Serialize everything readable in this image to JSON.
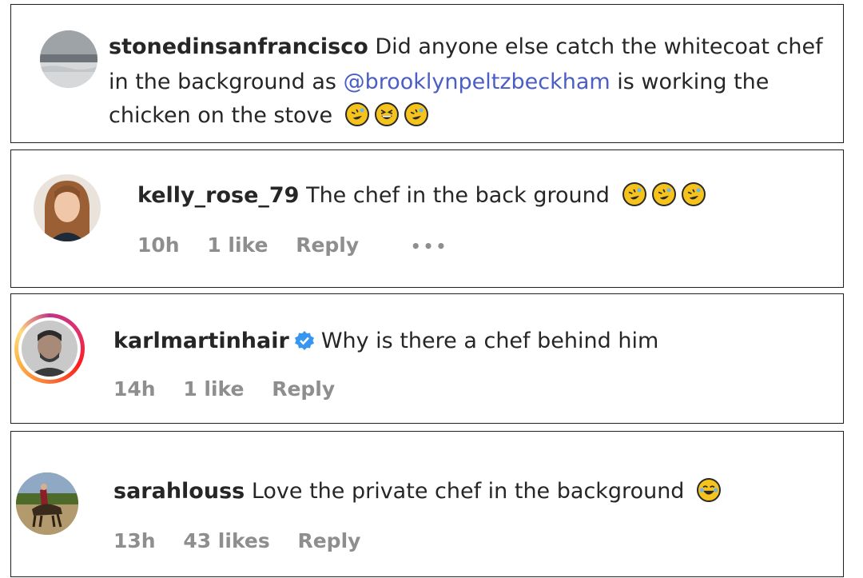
{
  "comments": [
    {
      "username": "stonedinsanfrancisco",
      "text_part1": "Did anyone else catch the whitecoat chef",
      "text_part2_before": "in the background as ",
      "mention": "@brooklynpeltzbeckham",
      "text_part2_after": " is working the",
      "text_part3": "chicken on the stove",
      "emojis": [
        "rolling-laughing-emoji",
        "grinning-squinting-emoji",
        "rolling-laughing-emoji"
      ]
    },
    {
      "username": "kelly_rose_79",
      "text": "The chef in the back ground",
      "emojis": [
        "rolling-laughing-emoji",
        "rolling-laughing-emoji",
        "rolling-laughing-emoji"
      ],
      "time": "10h",
      "likes": "1 like",
      "reply": "Reply",
      "more": "•••"
    },
    {
      "username": "karlmartinhair",
      "verified": true,
      "text": "Why is there a chef behind him",
      "time": "14h",
      "likes": "1 like",
      "reply": "Reply"
    },
    {
      "username": "sarahlouss",
      "text": "Love the private chef in the background",
      "emojis": [
        "tears-of-joy-emoji"
      ],
      "time": "13h",
      "likes": "43 likes",
      "reply": "Reply"
    }
  ],
  "colors": {
    "mention": "#4a5ec4",
    "meta_text": "#8e8e8e",
    "verified_badge": "#3797f0",
    "story_ring_start": "#c13584",
    "story_ring_end": "#fcaf45"
  }
}
